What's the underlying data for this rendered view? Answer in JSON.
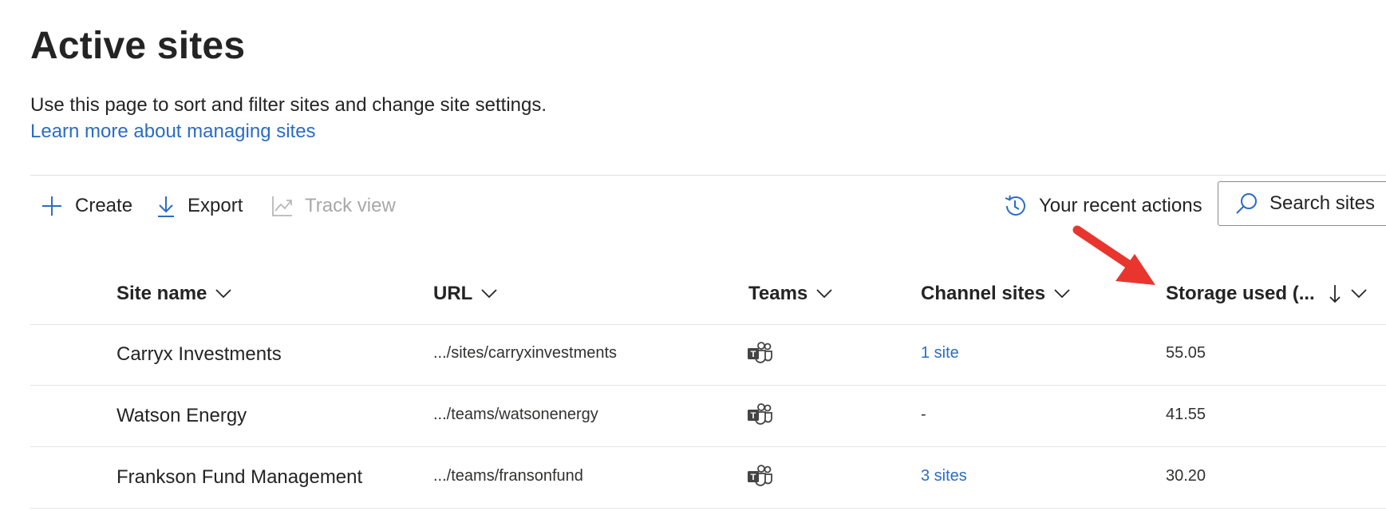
{
  "header": {
    "title": "Active sites",
    "description": "Use this page to sort and filter sites and change site settings.",
    "learn_more": "Learn more about managing sites"
  },
  "toolbar": {
    "create_label": "Create",
    "export_label": "Export",
    "track_view_label": "Track view",
    "recent_actions_label": "Your recent actions",
    "search_placeholder": "Search sites"
  },
  "table": {
    "columns": {
      "site_name": "Site name",
      "url": "URL",
      "teams": "Teams",
      "channel_sites": "Channel sites",
      "storage_used": "Storage used (..."
    },
    "rows": [
      {
        "site_name": "Carryx Investments",
        "url": ".../sites/carryxinvestments",
        "teams_icon": "teams-icon",
        "channel_sites": "1 site",
        "storage_used": "55.05"
      },
      {
        "site_name": "Watson Energy",
        "url": ".../teams/watsonenergy",
        "teams_icon": "teams-icon",
        "channel_sites": "-",
        "storage_used": "41.55"
      },
      {
        "site_name": "Frankson Fund Management",
        "url": ".../teams/fransonfund",
        "teams_icon": "teams-icon",
        "channel_sites": "3 sites",
        "storage_used": "30.20"
      }
    ]
  },
  "colors": {
    "link": "#2b6cc4",
    "annotation_arrow": "#e8362f",
    "text": "#242424"
  }
}
